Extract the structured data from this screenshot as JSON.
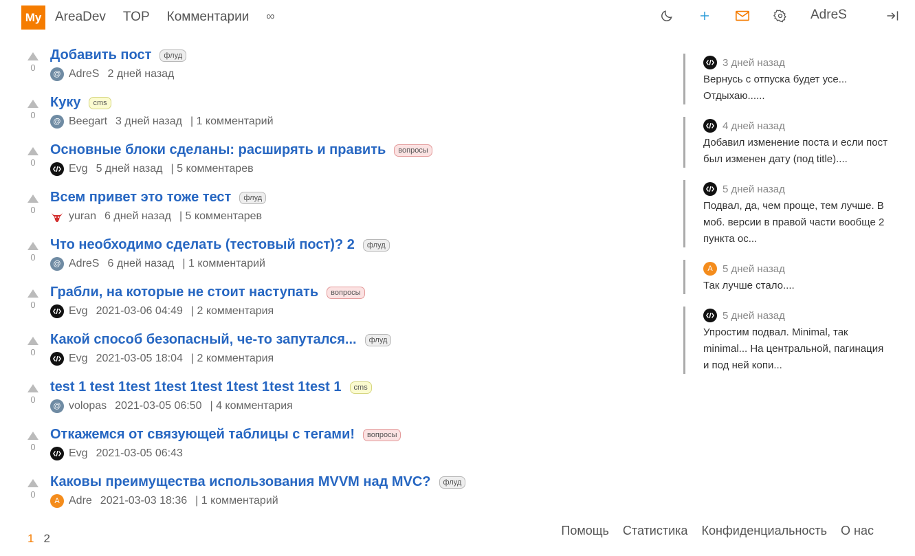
{
  "header": {
    "logo": "My",
    "nav": [
      "AreaDev",
      "TOP",
      "Комментарии",
      "∞"
    ],
    "username": "AdreS",
    "icons": [
      "moon-icon",
      "plus-icon",
      "mail-icon",
      "gear-icon",
      "logout-icon"
    ],
    "accent_color": "#f57c00"
  },
  "posts": [
    {
      "votes": "0",
      "title": "Добавить пост",
      "tag": "флуд",
      "tag_type": "flud",
      "avatar": "at",
      "author": "AdreS",
      "date": "2 дней назад",
      "comments": ""
    },
    {
      "votes": "0",
      "title": "Куку",
      "tag": "cms",
      "tag_type": "cms",
      "avatar": "at",
      "author": "Beegart",
      "date": "3 дней назад",
      "comments": "| 1 комментарий"
    },
    {
      "votes": "0",
      "title": "Основные блоки сделаны: расширять и править",
      "tag": "вопросы",
      "tag_type": "vop",
      "avatar": "code",
      "author": "Evg",
      "date": "5 дней назад",
      "comments": "| 5 комментарев"
    },
    {
      "votes": "0",
      "title": "Всем привет это тоже тест",
      "tag": "флуд",
      "tag_type": "flud",
      "avatar": "bull",
      "author": "yuran",
      "date": "6 дней назад",
      "comments": "| 5 комментарев"
    },
    {
      "votes": "0",
      "title": "Что необходимо сделать (тестовый пост)? 2",
      "tag": "флуд",
      "tag_type": "flud",
      "avatar": "at",
      "author": "AdreS",
      "date": "6 дней назад",
      "comments": "| 1 комментарий"
    },
    {
      "votes": "0",
      "title": "Грабли, на которые не стоит наступать",
      "tag": "вопросы",
      "tag_type": "vop",
      "avatar": "code",
      "author": "Evg",
      "date": "2021-03-06 04:49",
      "comments": "| 2 комментария"
    },
    {
      "votes": "0",
      "title": "Какой способ безопасный, че-то запутался...",
      "tag": "флуд",
      "tag_type": "flud",
      "avatar": "code",
      "author": "Evg",
      "date": "2021-03-05 18:04",
      "comments": "| 2 комментария"
    },
    {
      "votes": "0",
      "title": "test 1 test 1test 1test 1test 1test 1test 1test 1",
      "tag": "cms",
      "tag_type": "cms",
      "avatar": "at",
      "author": "volopas",
      "date": "2021-03-05 06:50",
      "comments": "| 4 комментария"
    },
    {
      "votes": "0",
      "title": "Откажемся от связующей таблицы с тегами!",
      "tag": "вопросы",
      "tag_type": "vop",
      "avatar": "code",
      "author": "Evg",
      "date": "2021-03-05 06:43",
      "comments": ""
    },
    {
      "votes": "0",
      "title": "Каковы преимущества использования MVVM над MVC?",
      "tag": "флуд",
      "tag_type": "flud",
      "avatar": "a",
      "author": "Adre",
      "date": "2021-03-03 18:36",
      "comments": "| 1 комментарий"
    }
  ],
  "sidebar": [
    {
      "avatar": "code",
      "time": "3 дней назад",
      "text": "Вернусь с отпуска будет усе... Отдыхаю......"
    },
    {
      "avatar": "code",
      "time": "4 дней назад",
      "text": "Добавил изменение поста и если пост был изменен дату (под title)...."
    },
    {
      "avatar": "code",
      "time": "5 дней назад",
      "text": "Подвал, да, чем проще, тем лучше. В моб. версии в правой части вообще 2 пункта ос..."
    },
    {
      "avatar": "a",
      "time": "5 дней назад",
      "text": "Так лучше стало...."
    },
    {
      "avatar": "code",
      "time": "5 дней назад",
      "text": "Упростим подвал. Minimal, так minimal... На центральной, пагинация и под ней копи..."
    }
  ],
  "pagination": [
    "1",
    "2"
  ],
  "footer": [
    "Помощь",
    "Статистика",
    "Конфиденциальность",
    "О нас"
  ]
}
